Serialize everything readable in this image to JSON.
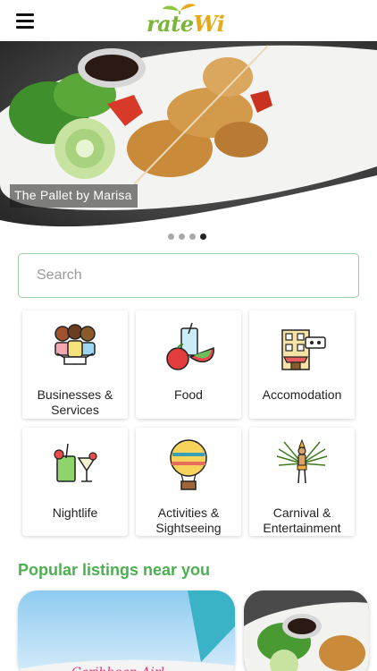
{
  "app": {
    "logo_text_main": "rate",
    "logo_text_accent": "Wi",
    "menu_icon": "hamburger-menu-icon"
  },
  "hero": {
    "caption": "The Pallet by Marisa",
    "slide_count": 4,
    "active_slide": 4
  },
  "search": {
    "placeholder": "Search",
    "value": ""
  },
  "categories": [
    {
      "label": "Businesses & Services",
      "icon": "business-people-icon"
    },
    {
      "label": "Food",
      "icon": "food-drink-icon"
    },
    {
      "label": "Accomodation",
      "icon": "hotel-building-icon"
    },
    {
      "label": "Nightlife",
      "icon": "cocktail-icon"
    },
    {
      "label": "Activities & Sightseeing",
      "icon": "hot-air-balloon-icon"
    },
    {
      "label": "Carnival & Entertainment",
      "icon": "carnival-costume-icon"
    }
  ],
  "popular": {
    "title": "Popular listings near you",
    "cards": [
      {
        "image": "airplane-photo"
      },
      {
        "image": "food-plate-photo"
      }
    ]
  },
  "colors": {
    "accent_green": "#4caf50",
    "search_border": "#9fd0a2",
    "logo_green": "#7bb63a",
    "logo_gold": "#e6a91a"
  }
}
